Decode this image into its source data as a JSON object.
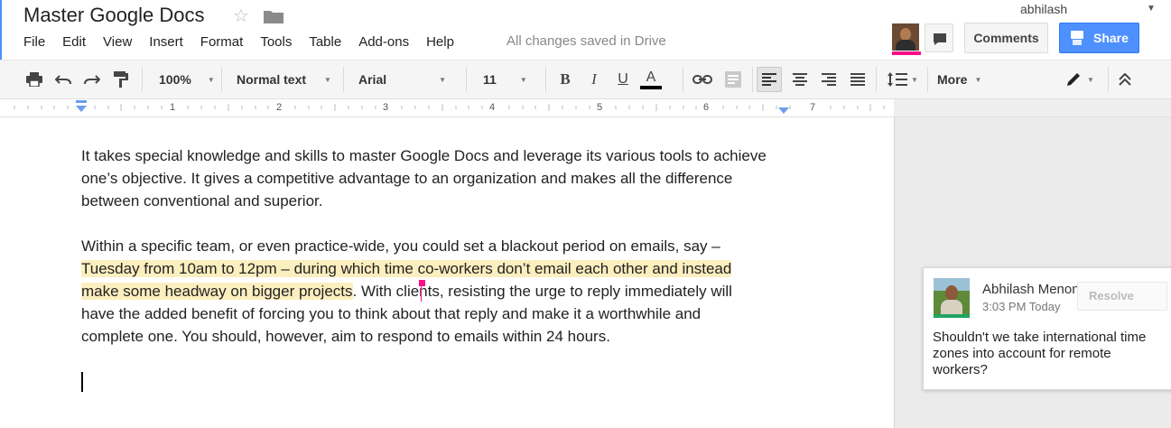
{
  "doc": {
    "title": "Master Google Docs",
    "saved_status": "All changes saved in Drive"
  },
  "menu": [
    "File",
    "Edit",
    "View",
    "Insert",
    "Format",
    "Tools",
    "Table",
    "Add-ons",
    "Help"
  ],
  "account": {
    "username": "abhilash"
  },
  "buttons": {
    "comments": "Comments",
    "share": "Share"
  },
  "toolbar": {
    "zoom": "100%",
    "style": "Normal text",
    "font": "Arial",
    "size": "11",
    "more": "More"
  },
  "ruler": {
    "numbers": [
      "1",
      "2",
      "3",
      "4",
      "5",
      "6",
      "7"
    ]
  },
  "body": {
    "para1": "It takes special knowledge and skills to master Google Docs and leverage its various tools to achieve one’s objective. It gives a competitive advantage to an organization and makes all the difference between conventional and superior.",
    "para2_line1": "Within a specific team, or even practice-wide, you could set a blackout period on emails, say –",
    "para2_hl_line2": "Tuesday from 10am to 12pm – during which time co-workers don’t email each other and instead",
    "para2_hl_line3": "make some headway on bigger projects",
    "para2_rest_line3": ". With clients, resisting the urge to reply immediately will",
    "para2_line4": "have the added benefit of forcing you to think about that reply and make it a worthwhile and",
    "para2_line5": "complete one. You should, however, aim to respond to emails within 24 hours."
  },
  "comment": {
    "author": "Abhilash Menon",
    "time": "3:03 PM Today",
    "resolve": "Resolve",
    "text": "Shouldn't we take international time zones into account for remote workers?"
  },
  "colors": {
    "accent_blue": "#4d90fe",
    "highlight": "#fcefbf",
    "collab_pink": "#ff0d86",
    "commenter_green": "#1fa463"
  }
}
